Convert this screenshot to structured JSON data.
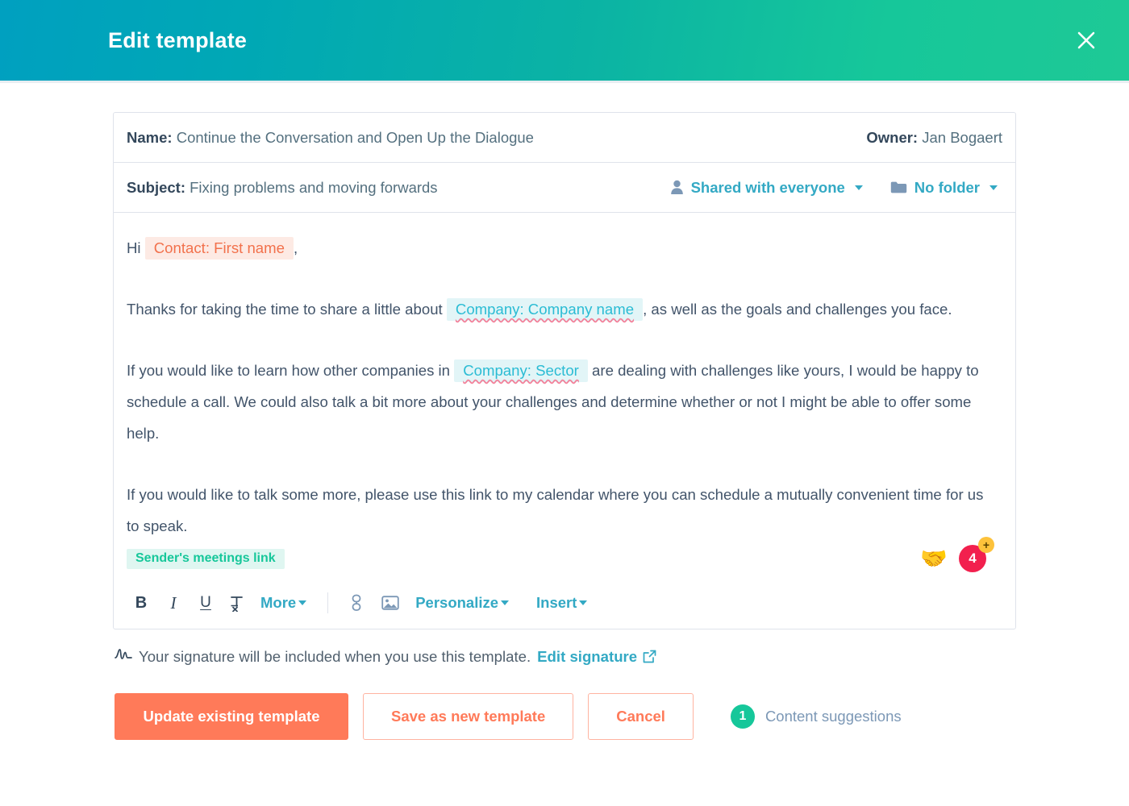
{
  "header": {
    "title": "Edit template",
    "close_icon": "close-icon",
    "gradient_start": "#00a0c0",
    "gradient_end": "#1ec996"
  },
  "template": {
    "name_label": "Name:",
    "name_value": "Continue the Conversation and Open Up the Dialogue",
    "owner_label": "Owner:",
    "owner_value": "Jan Bogaert",
    "subject_label": "Subject:",
    "subject_value": "Fixing problems and moving forwards",
    "sharing_label": "Shared with everyone",
    "folder_label": "No folder"
  },
  "body": {
    "greeting_prefix": "Hi",
    "token_contact_first_name": "Contact: First name",
    "greeting_suffix": ",",
    "p1_before": "Thanks for taking the time to share a little about",
    "token_company_name": "Company: Company name",
    "p1_after": ", as well as the goals and challenges you face.",
    "p2_before": "If you would like to learn how other companies in",
    "token_company_sector": "Company: Sector",
    "p2_after": "are dealing with challenges like yours, I would be happy to schedule a call. We could also talk a bit more about your challenges and determine whether or not I might be able to offer some help.",
    "p3": "If you would like to talk some more, please use this link to my calendar where you can schedule a mutually convenient time for us to speak.",
    "token_meetings_link": "Sender's meetings link",
    "reaction_emoji": "handshake-emoji",
    "reaction_count": "4",
    "add_reaction": "+"
  },
  "toolbar": {
    "bold": "B",
    "italic": "I",
    "underline": "U",
    "clear_format": "Tx",
    "more_label": "More",
    "link_icon": "link-icon",
    "image_icon": "image-icon",
    "personalize_label": "Personalize",
    "insert_label": "Insert"
  },
  "signature": {
    "note": "Your signature will be included when you use this template.",
    "link_label": "Edit signature",
    "external_icon": "external-link-icon",
    "signature_icon": "signature-icon"
  },
  "footer": {
    "primary_label": "Update existing template",
    "secondary_label": "Save as new template",
    "cancel_label": "Cancel",
    "suggestions_count": "1",
    "suggestions_label": "Content suggestions",
    "primary_color": "#ff7a59",
    "suggestion_badge_color": "#16c79a"
  }
}
